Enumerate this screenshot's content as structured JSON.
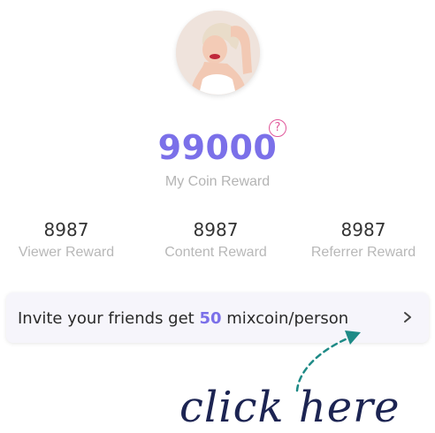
{
  "profile": {
    "avatar_icon": "user-avatar"
  },
  "coin": {
    "value": "99000",
    "label": "My Coin Reward",
    "help_icon_glyph": "?"
  },
  "stats": [
    {
      "value": "8987",
      "label": "Viewer Reward"
    },
    {
      "value": "8987",
      "label": "Content Reward"
    },
    {
      "value": "8987",
      "label": "Referrer Reward"
    }
  ],
  "invite": {
    "prefix": "Invite your friends get ",
    "amount": "50",
    "suffix": " mixcoin/person"
  },
  "annotation": {
    "text": "click  here"
  },
  "colors": {
    "accent": "#7b70e9",
    "help_pink": "#e0579a",
    "arrow_teal": "#1e8a86",
    "annotation_navy": "#1c2452"
  }
}
